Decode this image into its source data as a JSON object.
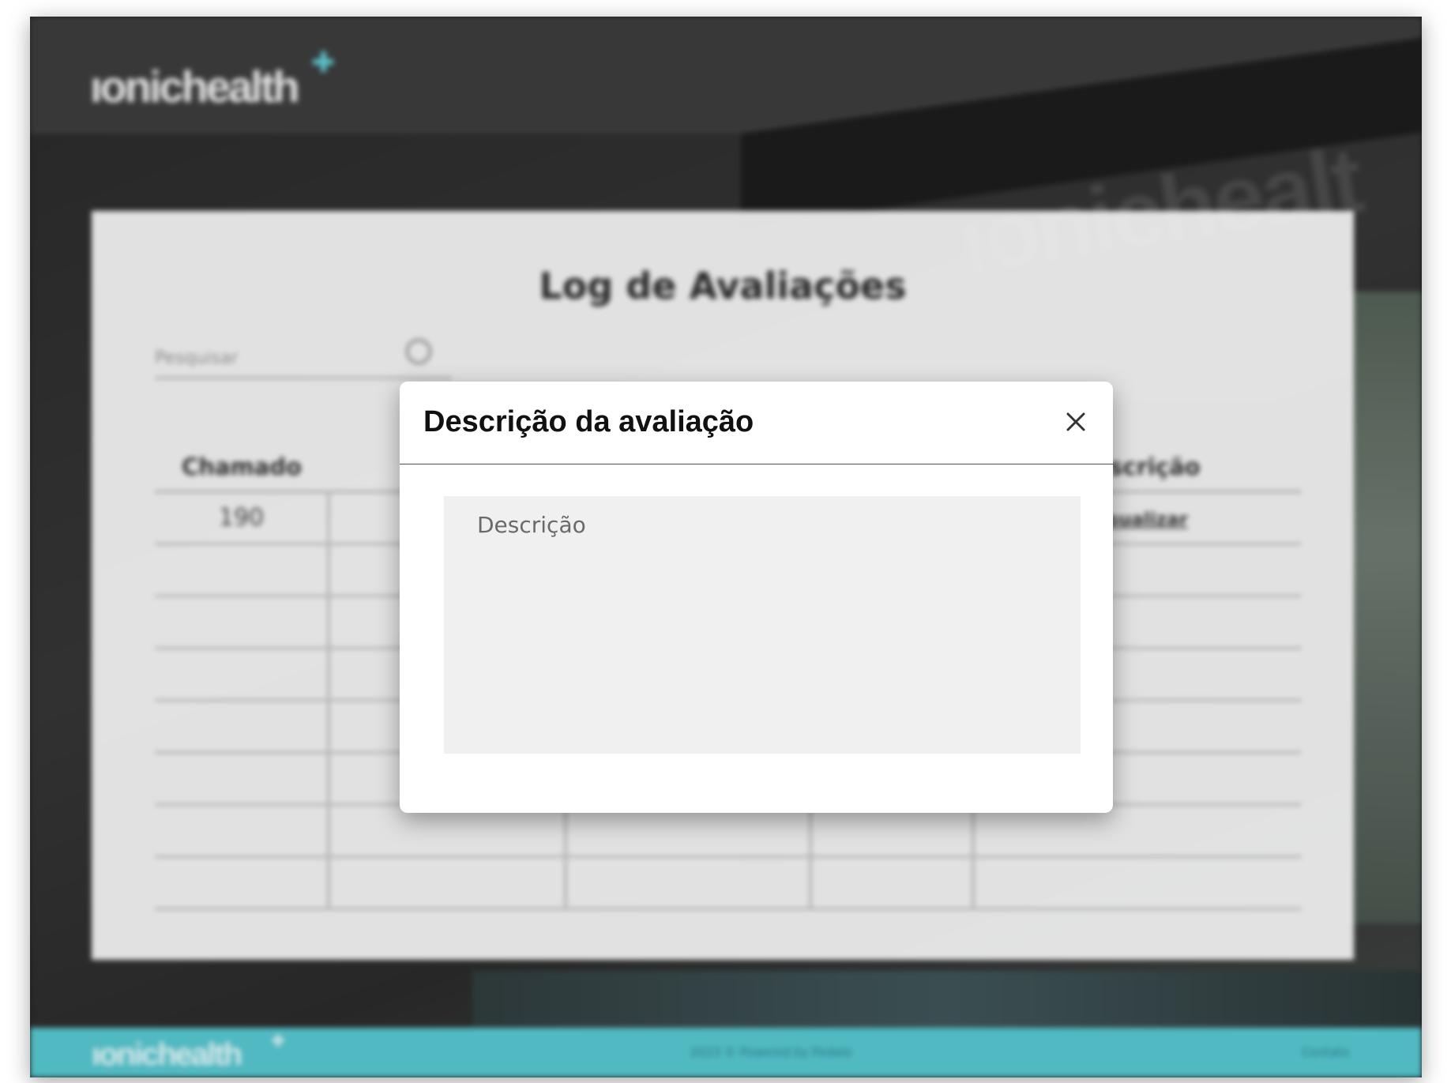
{
  "brand": {
    "name": "ıonichealth",
    "accent_color": "#5fcfd6"
  },
  "hero": {
    "wall_text": "ıonichealt"
  },
  "page": {
    "title": "Log de Avaliações",
    "search": {
      "placeholder": "Pesquisar",
      "icon": "search-icon"
    },
    "table": {
      "columns": [
        "Chamado",
        "",
        "",
        "",
        "Descrição"
      ],
      "rows": [
        {
          "chamado": "190",
          "descricao": "Visualizar"
        }
      ],
      "empty_rows": 7
    }
  },
  "footer": {
    "brand": "ıonichealth",
    "copyright": "2023 © Powered by Pedalo",
    "contact": "Contato",
    "color": "#55c3cc"
  },
  "modal": {
    "title": "Descrição da avaliação",
    "close_icon": "close-icon",
    "description": {
      "placeholder": "Descrição",
      "value": ""
    }
  }
}
